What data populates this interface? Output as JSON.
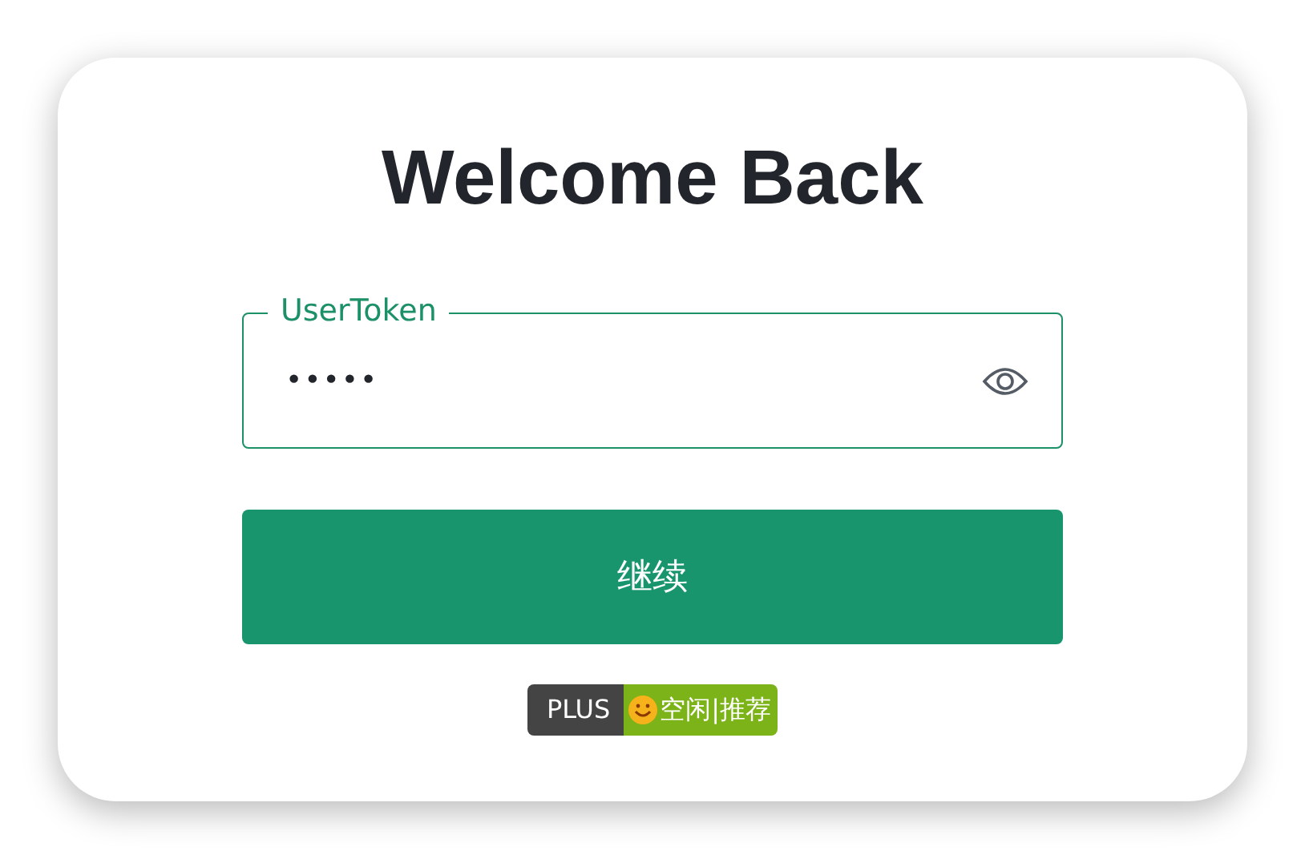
{
  "title": "Welcome Back",
  "token_field": {
    "label": "UserToken",
    "value": "•••••",
    "focused": true
  },
  "continue_button": {
    "label": "继续"
  },
  "badge": {
    "left": "PLUS",
    "right": "空闲|推荐"
  }
}
